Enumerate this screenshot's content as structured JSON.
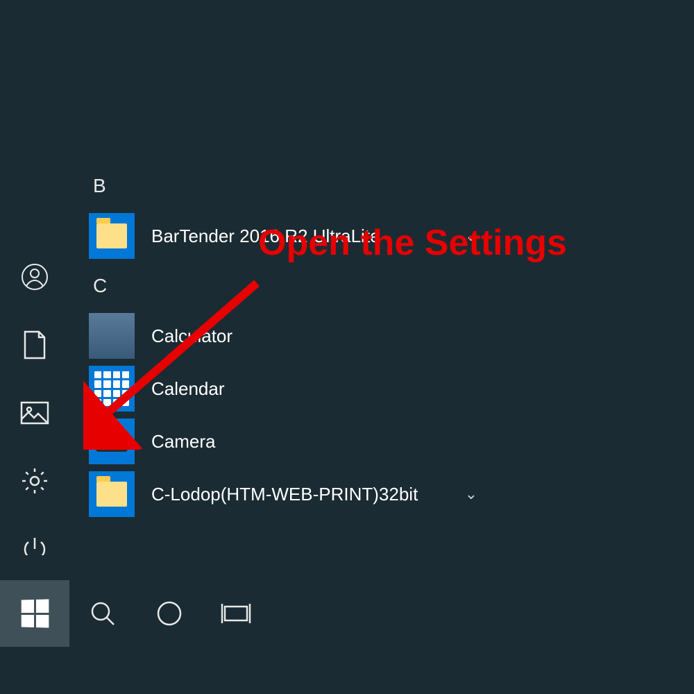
{
  "annotation": {
    "text": "Open the Settings"
  },
  "groups": {
    "b": {
      "header": "B"
    },
    "c": {
      "header": "C"
    }
  },
  "apps": {
    "bartender": {
      "label": "BarTender 2016 R2 UltraLite"
    },
    "calculator": {
      "label": "Calculator"
    },
    "calendar": {
      "label": "Calendar"
    },
    "camera": {
      "label": "Camera"
    },
    "clodop": {
      "label": "C-Lodop(HTM-WEB-PRINT)32bit"
    }
  }
}
